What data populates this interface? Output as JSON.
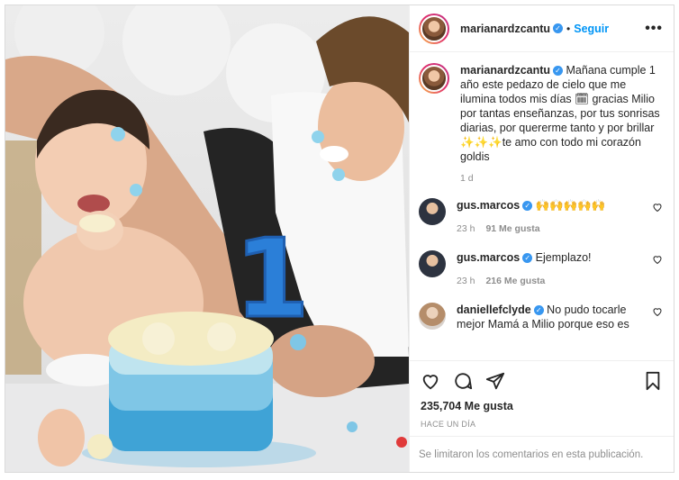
{
  "post": {
    "author": "marianardzcantu",
    "follow_label": "Seguir",
    "more_label": "•••",
    "caption": "Mañana cumple 1 año este pedazo de cielo que me ilumina todos mis días 🗓 gracias Milio por tantas enseñanzas, por tus sonrisas diarias, por quererme tanto y por brillar ✨✨✨te amo con todo mi corazón goldis",
    "caption_age": "1 d",
    "likes": "235,704 Me gusta",
    "posted_ago": "HACE UN DÍA",
    "comments_limited": "Se limitaron los comentarios en esta publicación."
  },
  "comments": [
    {
      "user": "gus.marcos",
      "text": "🙌🙌🙌🙌🙌",
      "age": "23 h",
      "likes": "91 Me gusta"
    },
    {
      "user": "gus.marcos",
      "text": "Ejemplazo!",
      "age": "23 h",
      "likes": "216 Me gusta"
    },
    {
      "user": "daniellefclyde",
      "text": "No pudo tocarle mejor Mamá a Milio porque eso es",
      "age": "",
      "likes": ""
    }
  ],
  "photo": {
    "cake_number": "1"
  },
  "colors": {
    "accent": "#0095f6",
    "verified": "#3897f0",
    "cake_blue": "#5fb8e0"
  },
  "icons": [
    "heart-icon",
    "comment-icon",
    "share-icon",
    "bookmark-icon",
    "verified-icon",
    "more-options-icon"
  ]
}
